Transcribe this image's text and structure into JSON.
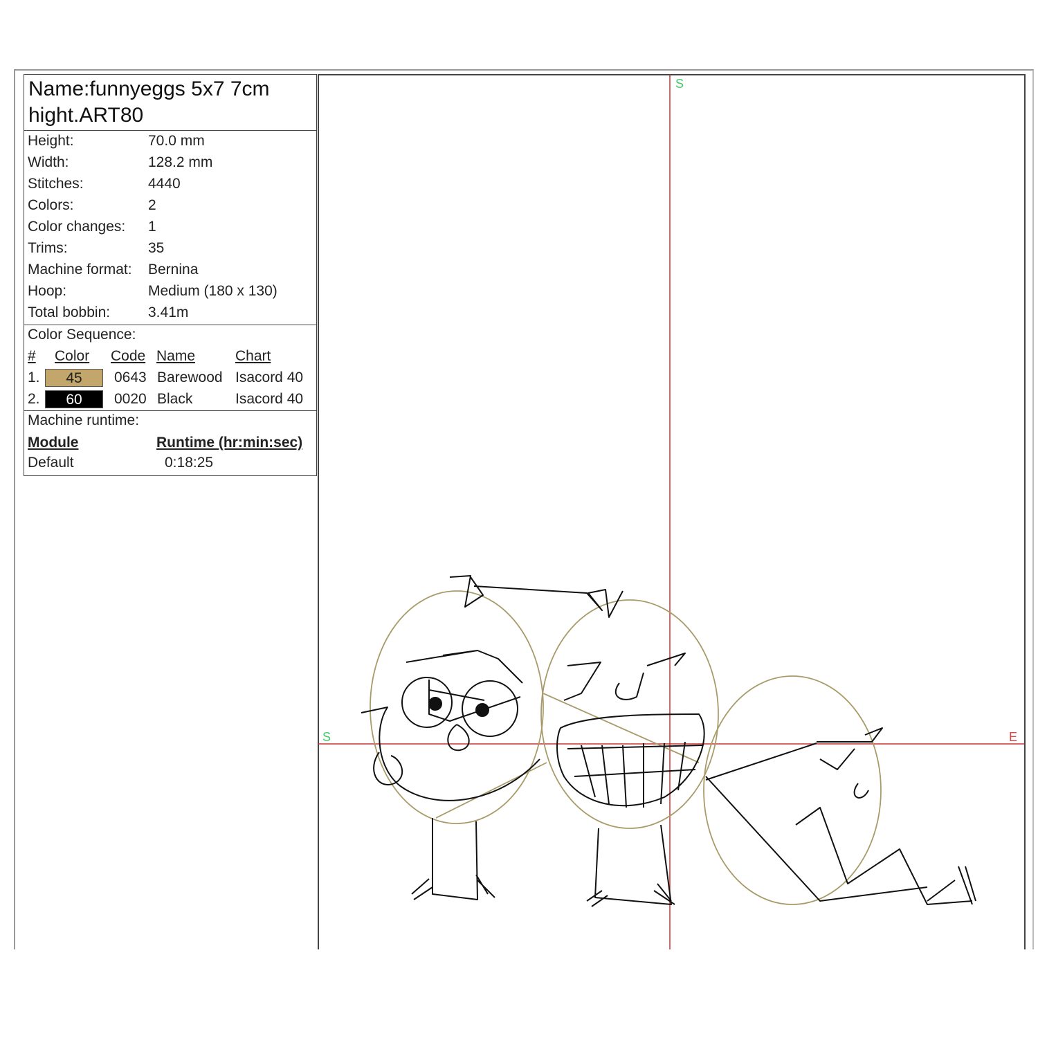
{
  "design_name": {
    "line1": "Name:funnyeggs 5x7 7cm",
    "line2": "hight.ART80"
  },
  "stats": [
    {
      "label": "Height:",
      "value": "70.0 mm"
    },
    {
      "label": "Width:",
      "value": "128.2 mm"
    },
    {
      "label": "Stitches:",
      "value": "4440"
    },
    {
      "label": "Colors:",
      "value": "2"
    },
    {
      "label": "Color changes:",
      "value": "1"
    },
    {
      "label": "Trims:",
      "value": "35"
    },
    {
      "label": "Machine format:",
      "value": "Bernina"
    },
    {
      "label": "Hoop:",
      "value": "Medium (180 x 130)"
    },
    {
      "label": "Total bobbin:",
      "value": "3.41m"
    }
  ],
  "color_sequence": {
    "title": "Color Sequence:",
    "headers": {
      "num": "#",
      "color": "Color",
      "code": "Code",
      "name": "Name",
      "chart": "Chart"
    },
    "rows": [
      {
        "num": "1.",
        "swatch_label": "45",
        "swatch_color": "#c2a66b",
        "swatch_text_color": "#222222",
        "code": "0643",
        "name": "Barewood",
        "chart": "Isacord 40"
      },
      {
        "num": "2.",
        "swatch_label": "60",
        "swatch_color": "#000000",
        "swatch_text_color": "#ffffff",
        "code": "0020",
        "name": "Black",
        "chart": "Isacord 40"
      }
    ]
  },
  "runtime": {
    "title": "Machine runtime:",
    "headers": {
      "module": "Module",
      "runtime": "Runtime (hr:min:sec)"
    },
    "rows": [
      {
        "module": "Default",
        "runtime": "0:18:25"
      }
    ]
  },
  "markers": {
    "start_top": "S",
    "start_left": "S",
    "end_right": "E"
  },
  "colors": {
    "axis": "#cc3333",
    "marker": "#44cc66",
    "end_marker": "#dd4444",
    "outline_thread": "#a89b6a",
    "black_thread": "#111111"
  }
}
